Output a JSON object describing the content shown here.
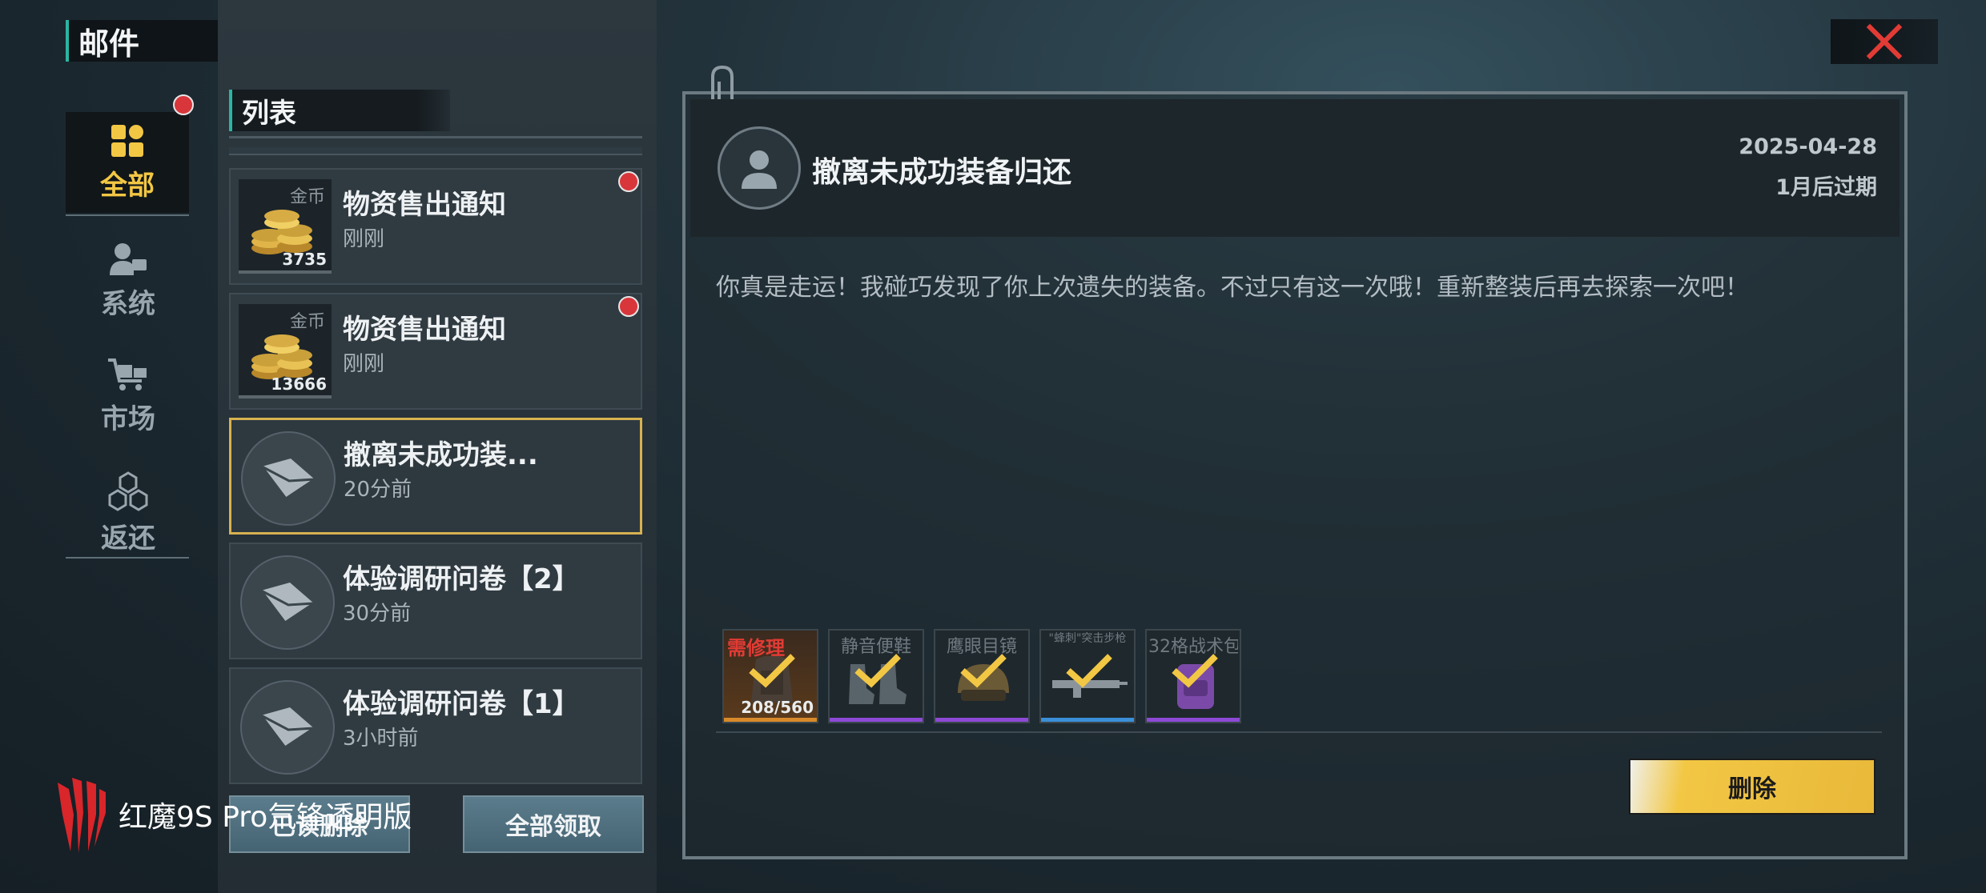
{
  "header": {
    "title": "邮件"
  },
  "categories": [
    {
      "label": "全部",
      "icon": "grid-icon",
      "active": true,
      "has_badge": true
    },
    {
      "label": "系统",
      "icon": "user-system-icon",
      "active": false
    },
    {
      "label": "市场",
      "icon": "cart-icon",
      "active": false
    },
    {
      "label": "返还",
      "icon": "cubes-icon",
      "active": false
    }
  ],
  "list": {
    "title": "列表",
    "items": [
      {
        "title": "物资售出通知",
        "time": "刚刚",
        "thumb_label": "金币",
        "thumb_count": "3735",
        "unread": true
      },
      {
        "title": "物资售出通知",
        "time": "刚刚",
        "thumb_label": "金币",
        "thumb_count": "13666",
        "unread": true
      },
      {
        "title": "撤离未成功装...",
        "time": "20分前",
        "selected": true
      },
      {
        "title": "体验调研问卷【2】",
        "time": "30分前"
      },
      {
        "title": "体验调研问卷【1】",
        "time": "3小时前"
      }
    ],
    "delete_read_label": "已读删除",
    "claim_all_label": "全部领取"
  },
  "detail": {
    "title": "撤离未成功装备归还",
    "date": "2025-04-28",
    "expire": "1月后过期",
    "body": "你真是走运！我碰巧发现了你上次遗失的装备。不过只有这一次哦！重新整装后再去探索一次吧！",
    "attachments": [
      {
        "name": "需修理",
        "status": "需修理",
        "count": "208/560",
        "rarity_color": "#d88a2a"
      },
      {
        "name": "静音便鞋",
        "rarity_color": "#8d49d6"
      },
      {
        "name": "鹰眼目镜",
        "rarity_color": "#8d49d6"
      },
      {
        "name": "\"蜂刺\"突击步枪",
        "rarity_color": "#3a8fd8"
      },
      {
        "name": "32格战术包",
        "rarity_color": "#8d49d6"
      }
    ],
    "delete_label": "删除"
  },
  "watermark": {
    "text": "红魔9S Pro氘锋透明版"
  }
}
